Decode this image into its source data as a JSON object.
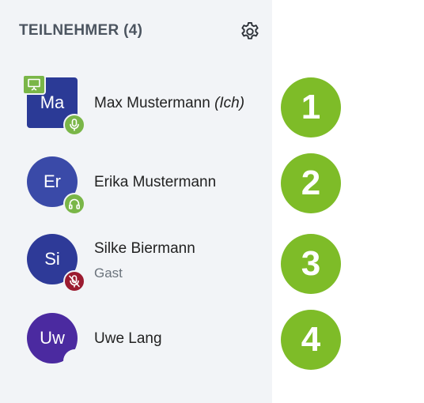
{
  "panel": {
    "title": "TEILNEHMER (4)",
    "settings_icon": "gear-icon"
  },
  "participants": [
    {
      "initials": "Ma",
      "name": "Max Mustermann",
      "suffix": "(Ich)",
      "subtitle": "",
      "avatar_color": "#2b3a96",
      "avatar_shape": "square",
      "presenter": true,
      "status_icon": "microphone-icon",
      "status_color": "#7ab648"
    },
    {
      "initials": "Er",
      "name": "Erika Mustermann",
      "suffix": "",
      "subtitle": "",
      "avatar_color": "#3a4aa8",
      "avatar_shape": "round",
      "presenter": false,
      "status_icon": "headset-icon",
      "status_color": "#7ab648"
    },
    {
      "initials": "Si",
      "name": "Silke Biermann",
      "suffix": "",
      "subtitle": "Gast",
      "avatar_color": "#2e3a98",
      "avatar_shape": "round",
      "presenter": false,
      "status_icon": "microphone-muted-icon",
      "status_color": "#9b1b30"
    },
    {
      "initials": "Uw",
      "name": "Uwe Lang",
      "suffix": "",
      "subtitle": "",
      "avatar_color": "#4b2aa0",
      "avatar_shape": "round",
      "presenter": false,
      "status_icon": "",
      "status_color": ""
    }
  ],
  "markers": [
    "1",
    "2",
    "3",
    "4"
  ],
  "colors": {
    "panel_bg": "#f2f4f7",
    "marker": "#7ebc28"
  }
}
